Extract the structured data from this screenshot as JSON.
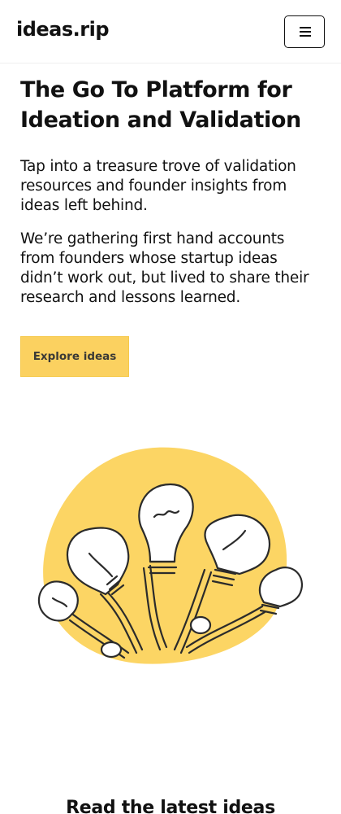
{
  "header": {
    "logo": "ideas.rip",
    "menu_icon": "hamburger-menu-icon"
  },
  "hero": {
    "title": "The Go To Platform for Ideation and Validation",
    "paragraph_1": "Tap into a treasure trove of validation resources and founder insights from ideas left behind.",
    "paragraph_2": "We’re gathering first hand accounts from founders whose startup ideas didn’t work out, but lived to share their research and lessons learned.",
    "cta_label": "Explore ideas",
    "illustration": "light-bulbs-illustration"
  },
  "latest": {
    "title": "Read the latest ideas"
  },
  "colors": {
    "accent": "#fbd160",
    "text": "#111111",
    "button_text": "#3b3a36",
    "background": "#ffffff"
  }
}
